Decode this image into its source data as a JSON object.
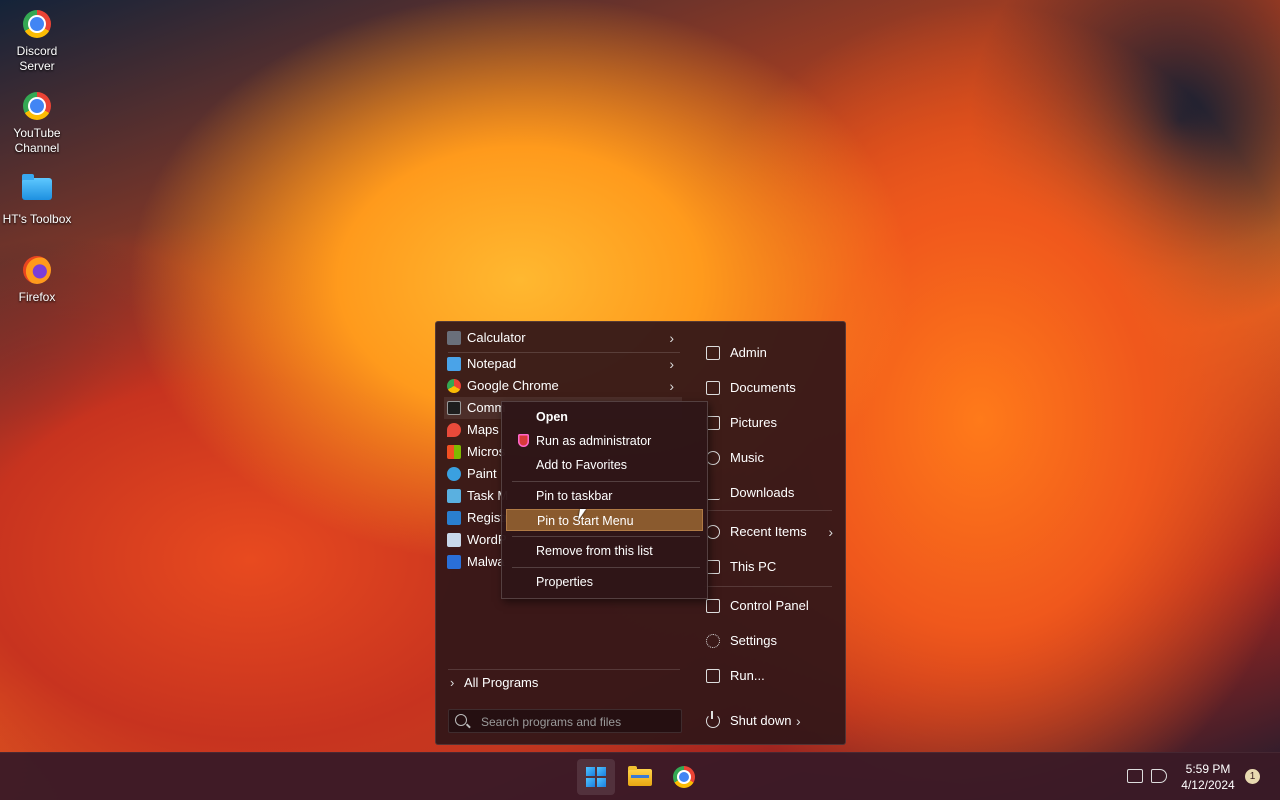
{
  "desktop": {
    "icons": [
      {
        "label_1": "Discord",
        "label_2": "Server",
        "icon": "chrome-shortcut-icon"
      },
      {
        "label_1": "YouTube",
        "label_2": "Channel",
        "icon": "chrome-shortcut-icon"
      },
      {
        "label_1": "HT's Toolbox",
        "icon": "folder-icon"
      },
      {
        "label_1": "Firefox",
        "icon": "firefox-icon"
      }
    ]
  },
  "start_menu": {
    "programs": [
      {
        "label": "Calculator",
        "icon": "calculator-icon",
        "has_submenu": true
      },
      {
        "label": "Notepad",
        "icon": "notepad-icon",
        "has_submenu": true
      },
      {
        "label": "Google Chrome",
        "icon": "chrome-icon",
        "has_submenu": true
      },
      {
        "label": "Comm",
        "icon": "command-prompt-icon"
      },
      {
        "label": "Maps",
        "icon": "maps-icon"
      },
      {
        "label": "Micros",
        "icon": "microsoft-store-icon"
      },
      {
        "label": "Paint",
        "icon": "paint-icon"
      },
      {
        "label": "Task M",
        "icon": "task-manager-icon"
      },
      {
        "label": "Registr",
        "icon": "registry-editor-icon"
      },
      {
        "label": "WordP",
        "icon": "wordpad-icon"
      },
      {
        "label": "Malwa",
        "icon": "malware-icon"
      }
    ],
    "all_programs_label": "All Programs",
    "search_placeholder": "Search programs and files",
    "places": [
      {
        "label": "Admin",
        "icon": "user-folder-icon"
      },
      {
        "label": "Documents",
        "icon": "documents-icon"
      },
      {
        "label": "Pictures",
        "icon": "pictures-icon"
      },
      {
        "label": "Music",
        "icon": "music-icon"
      },
      {
        "label": "Downloads",
        "icon": "downloads-icon"
      },
      {
        "label": "Recent Items",
        "icon": "clock-icon",
        "has_submenu": true
      },
      {
        "label": "This PC",
        "icon": "computer-icon"
      },
      {
        "label": "Control Panel",
        "icon": "control-panel-icon"
      },
      {
        "label": "Settings",
        "icon": "gear-icon"
      },
      {
        "label": "Run...",
        "icon": "run-icon"
      }
    ],
    "shutdown_label": "Shut down"
  },
  "context_menu": {
    "items": [
      {
        "label": "Open",
        "bold": true
      },
      {
        "label": "Run as administrator",
        "icon": "shield-icon"
      },
      {
        "label": "Add to Favorites"
      },
      {
        "label": "Pin to taskbar"
      },
      {
        "label": "Pin to Start Menu",
        "highlighted": true
      },
      {
        "label": "Remove from this list"
      },
      {
        "label": "Properties"
      }
    ]
  },
  "taskbar": {
    "apps": [
      "start-icon",
      "file-explorer-icon",
      "chrome-icon"
    ],
    "time": "5:59 PM",
    "date": "4/12/2024",
    "notification_count": "1"
  }
}
